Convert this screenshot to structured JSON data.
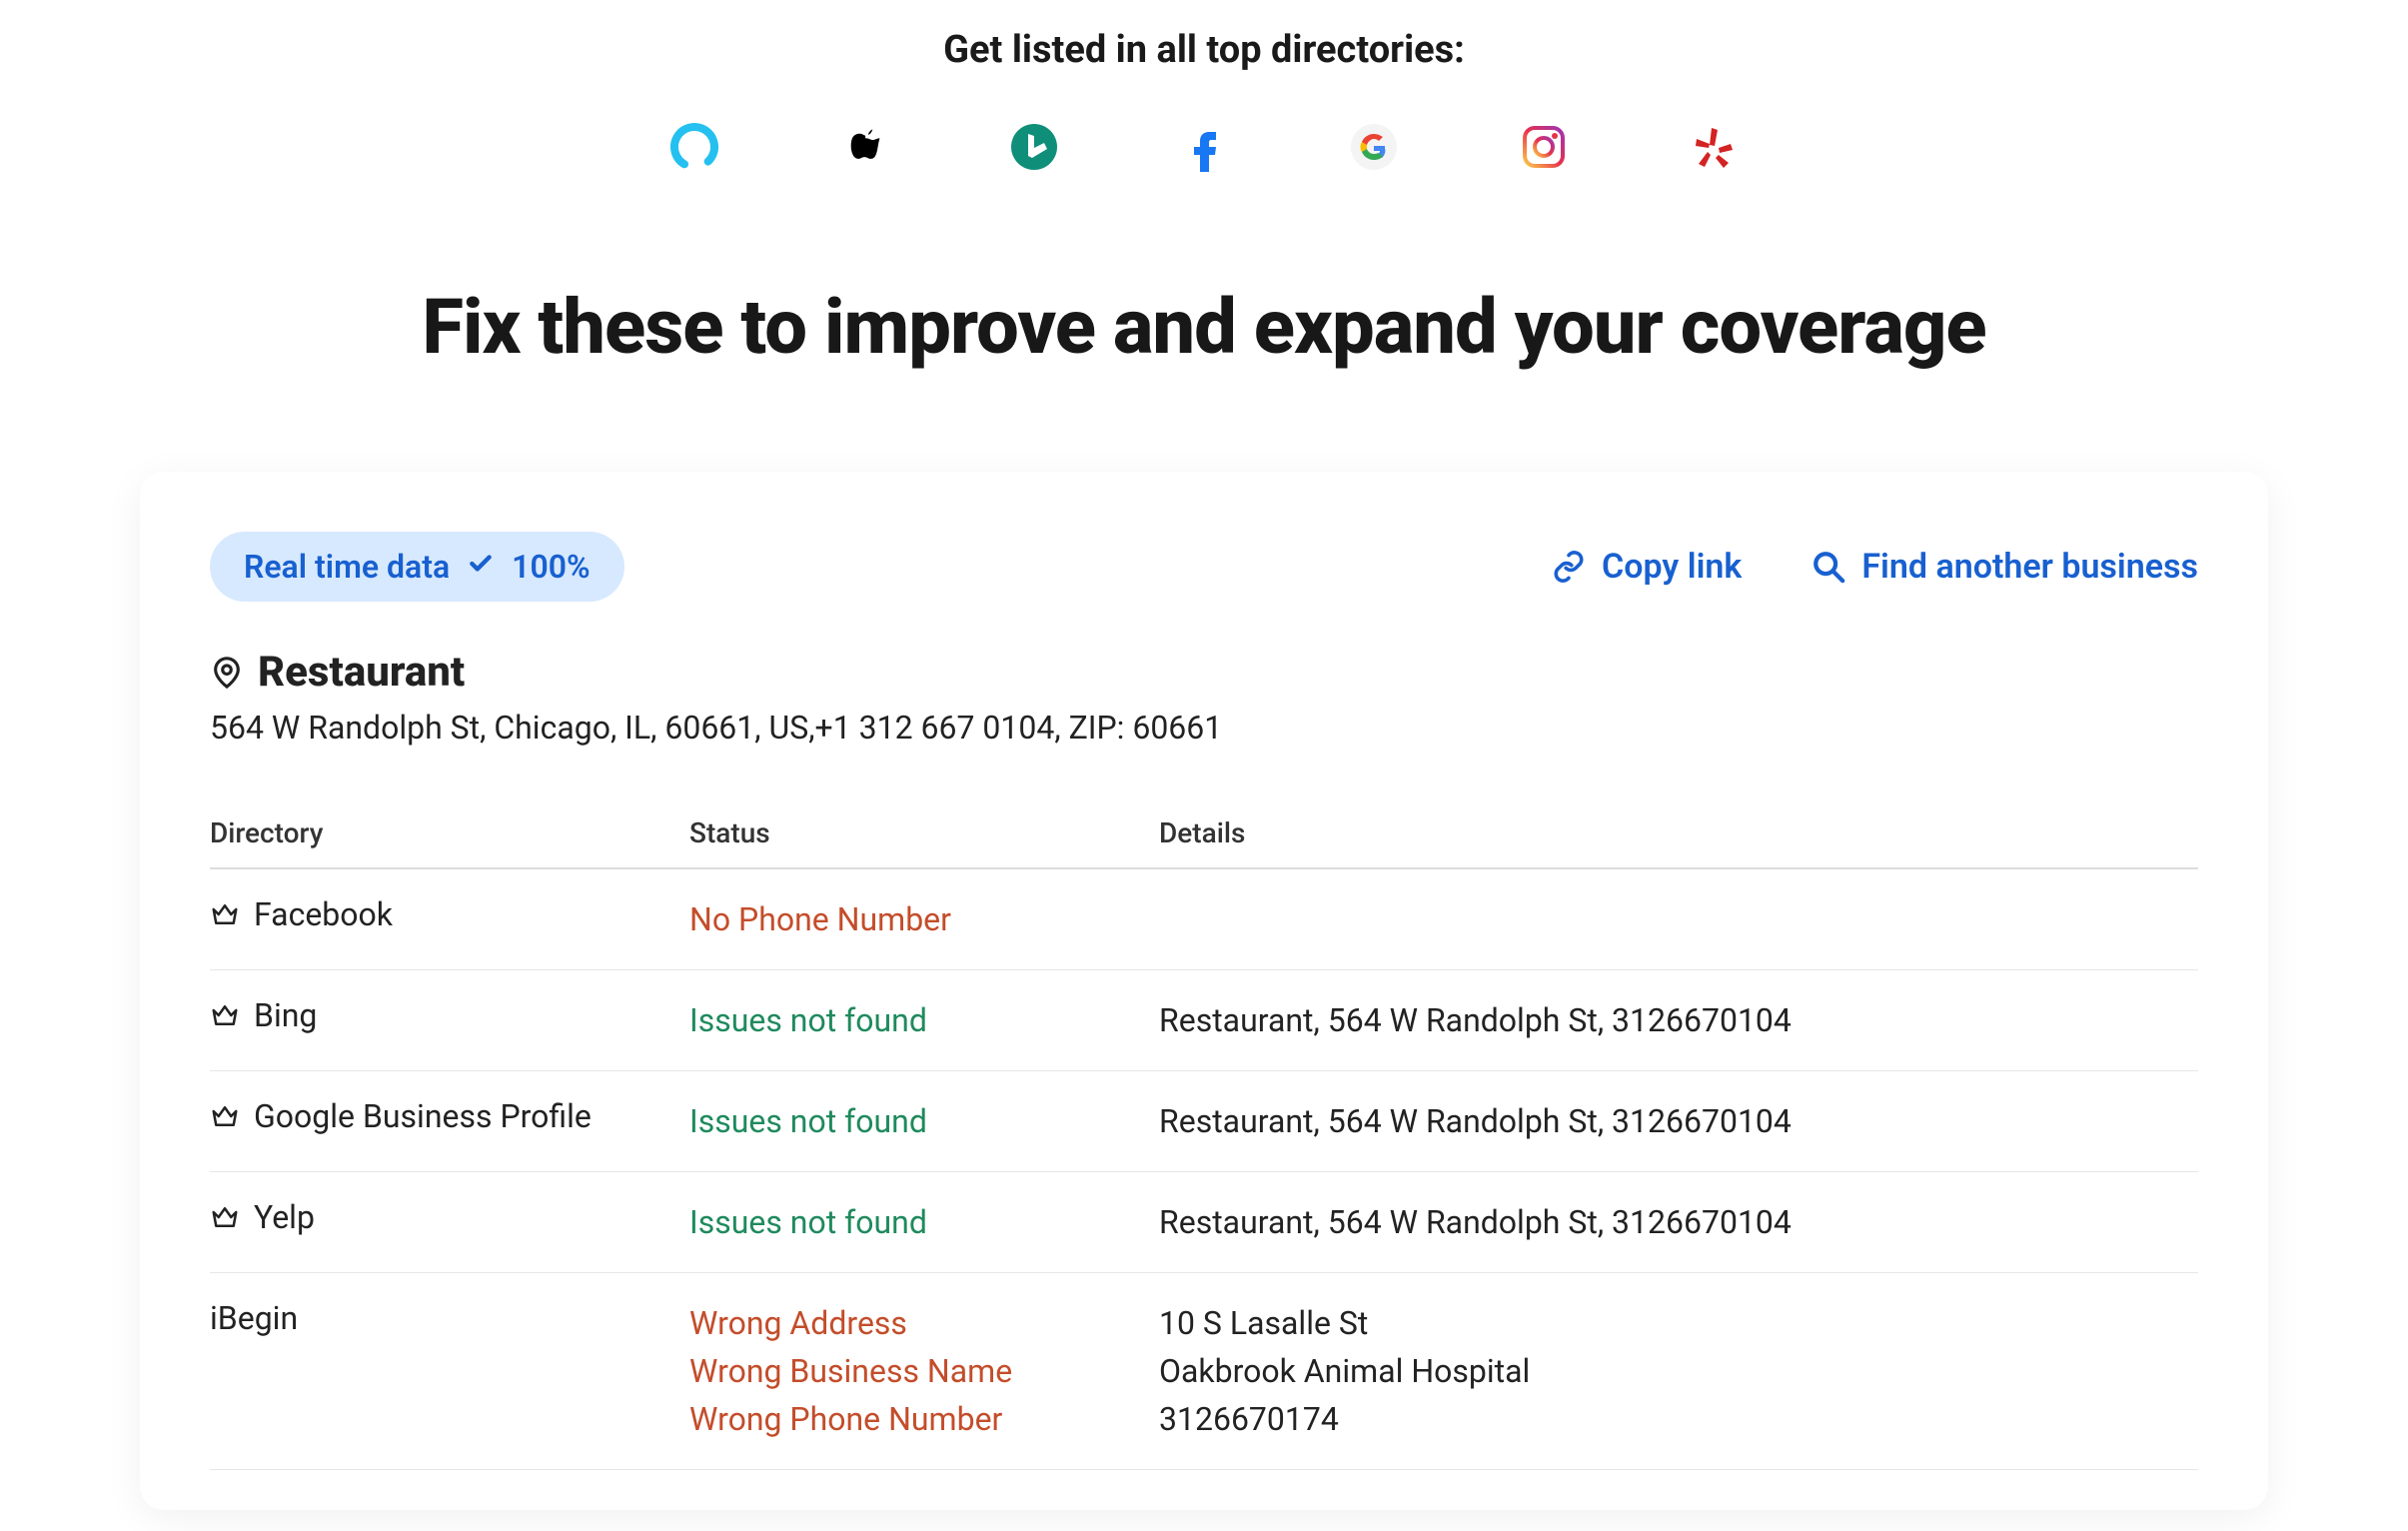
{
  "top": {
    "heading": "Get listed in all top directories:",
    "icons": [
      "alexa",
      "apple",
      "bing",
      "facebook",
      "google",
      "instagram",
      "yelp"
    ]
  },
  "fixHeading": "Fix these to improve and expand your coverage",
  "badge": {
    "label": "Real time data",
    "percent": "100%"
  },
  "actions": {
    "copy": "Copy link",
    "find": "Find another business"
  },
  "business": {
    "name": "Restaurant",
    "address": "564 W Randolph St, Chicago, IL, 60661, US,+1 312 667 0104, ZIP: 60661"
  },
  "table": {
    "headers": {
      "directory": "Directory",
      "status": "Status",
      "details": "Details"
    },
    "rows": [
      {
        "directory": "Facebook",
        "hasCrown": true,
        "statusType": "error",
        "statusLines": [
          "No Phone Number"
        ],
        "detailLines": []
      },
      {
        "directory": "Bing",
        "hasCrown": true,
        "statusType": "ok",
        "statusLines": [
          "Issues not found"
        ],
        "detailLines": [
          "Restaurant, 564 W Randolph St, 3126670104"
        ]
      },
      {
        "directory": "Google Business Profile",
        "hasCrown": true,
        "statusType": "ok",
        "statusLines": [
          "Issues not found"
        ],
        "detailLines": [
          "Restaurant, 564 W Randolph St, 3126670104"
        ]
      },
      {
        "directory": "Yelp",
        "hasCrown": true,
        "statusType": "ok",
        "statusLines": [
          "Issues not found"
        ],
        "detailLines": [
          "Restaurant, 564 W Randolph St, 3126670104"
        ]
      },
      {
        "directory": "iBegin",
        "hasCrown": false,
        "statusType": "error",
        "statusLines": [
          "Wrong Address",
          "Wrong Business Name",
          "Wrong Phone Number"
        ],
        "detailLines": [
          "10 S Lasalle St",
          "Oakbrook Animal Hospital",
          "3126670174"
        ]
      }
    ]
  }
}
